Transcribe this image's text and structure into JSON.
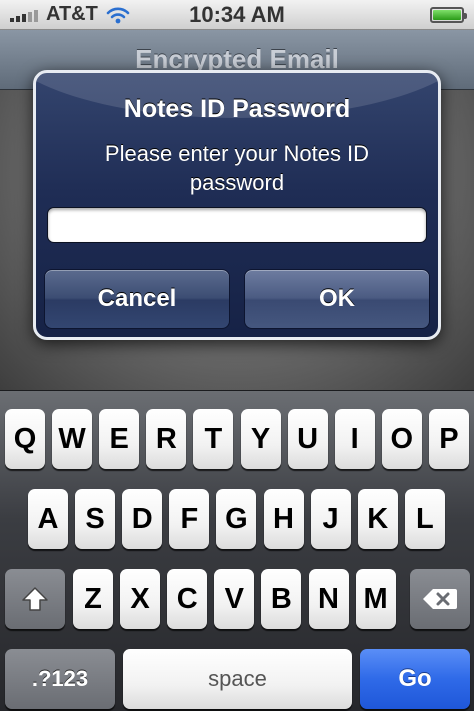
{
  "status_bar": {
    "carrier": "AT&T",
    "time": "10:34 AM",
    "battery_level": 1.0
  },
  "app": {
    "title": "Encrypted Email"
  },
  "alert": {
    "title": "Notes ID Password",
    "message": "Please enter your Notes ID password",
    "password_value": "",
    "cancel_label": "Cancel",
    "ok_label": "OK"
  },
  "keyboard": {
    "row1": [
      "Q",
      "W",
      "E",
      "R",
      "T",
      "Y",
      "U",
      "I",
      "O",
      "P"
    ],
    "row2": [
      "A",
      "S",
      "D",
      "F",
      "G",
      "H",
      "J",
      "K",
      "L"
    ],
    "row3": [
      "Z",
      "X",
      "C",
      "V",
      "B",
      "N",
      "M"
    ],
    "numbers_label": ".?123",
    "space_label": "space",
    "go_label": "Go",
    "shift_icon": "shift-arrow-icon",
    "backspace_icon": "backspace-icon"
  },
  "colors": {
    "alert_background": "#1f2d55",
    "go_key": "#2f6ae8",
    "battery": "#2a9a18"
  }
}
